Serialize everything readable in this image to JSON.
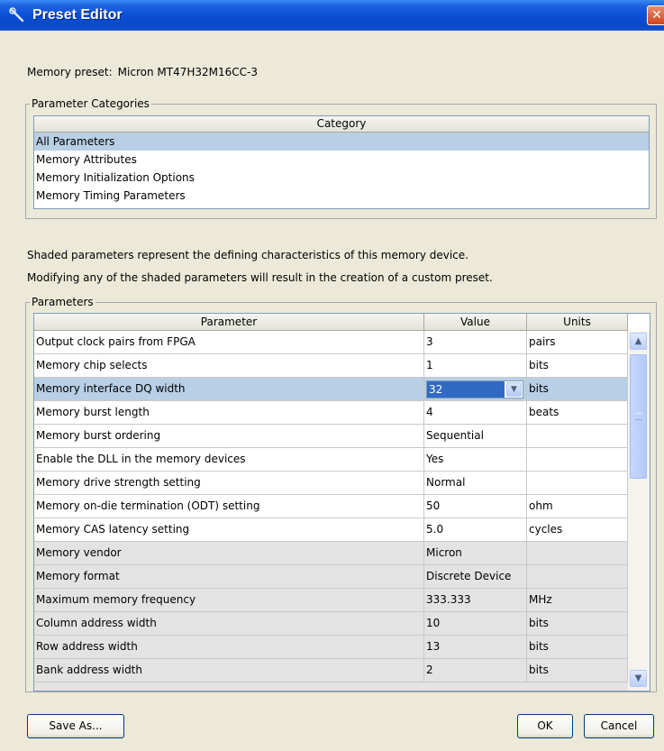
{
  "window": {
    "title": "Preset Editor",
    "close_symbol": "✕",
    "icon": "wrench-icon"
  },
  "preset": {
    "label": "Memory preset:",
    "name": "Micron MT47H32M16CC-3"
  },
  "categories_group": {
    "legend": "Parameter Categories",
    "header": "Category",
    "items": [
      {
        "label": "All Parameters",
        "selected": true
      },
      {
        "label": "Memory Attributes",
        "selected": false
      },
      {
        "label": "Memory Initialization Options",
        "selected": false
      },
      {
        "label": "Memory Timing Parameters",
        "selected": false
      }
    ]
  },
  "info": {
    "line1": "Shaded parameters represent the defining characteristics of this memory device.",
    "line2": "Modifying any of the shaded parameters will result in the creation of a custom preset."
  },
  "parameters_group": {
    "legend": "Parameters",
    "headers": {
      "parameter": "Parameter",
      "value": "Value",
      "units": "Units"
    },
    "rows": [
      {
        "parameter": "Output clock pairs from FPGA",
        "value": "3",
        "units": "pairs",
        "shaded": false
      },
      {
        "parameter": "Memory chip selects",
        "value": "1",
        "units": "bits",
        "shaded": false
      },
      {
        "parameter": "Memory interface DQ width",
        "value": "32",
        "units": "bits",
        "shaded": false,
        "selected": true
      },
      {
        "parameter": "Memory burst length",
        "value": "4",
        "units": "beats",
        "shaded": false
      },
      {
        "parameter": "Memory burst ordering",
        "value": "Sequential",
        "units": "",
        "shaded": false
      },
      {
        "parameter": "Enable the DLL in the memory devices",
        "value": "Yes",
        "units": "",
        "shaded": false
      },
      {
        "parameter": "Memory drive strength setting",
        "value": "Normal",
        "units": "",
        "shaded": false
      },
      {
        "parameter": "Memory on-die termination (ODT) setting",
        "value": "50",
        "units": "ohm",
        "shaded": false
      },
      {
        "parameter": "Memory CAS latency setting",
        "value": "5.0",
        "units": "cycles",
        "shaded": false
      },
      {
        "parameter": "Memory vendor",
        "value": "Micron",
        "units": "",
        "shaded": true
      },
      {
        "parameter": "Memory format",
        "value": "Discrete Device",
        "units": "",
        "shaded": true
      },
      {
        "parameter": "Maximum memory frequency",
        "value": "333.333",
        "units": "MHz",
        "shaded": true
      },
      {
        "parameter": "Column address width",
        "value": "10",
        "units": "bits",
        "shaded": true
      },
      {
        "parameter": "Row address width",
        "value": "13",
        "units": "bits",
        "shaded": true
      },
      {
        "parameter": "Bank address width",
        "value": "2",
        "units": "bits",
        "shaded": true
      }
    ]
  },
  "buttons": {
    "save_as": "Save As...",
    "ok": "OK",
    "cancel": "Cancel"
  },
  "scrollbar": {
    "up_symbol": "▲",
    "down_symbol": "▼"
  }
}
